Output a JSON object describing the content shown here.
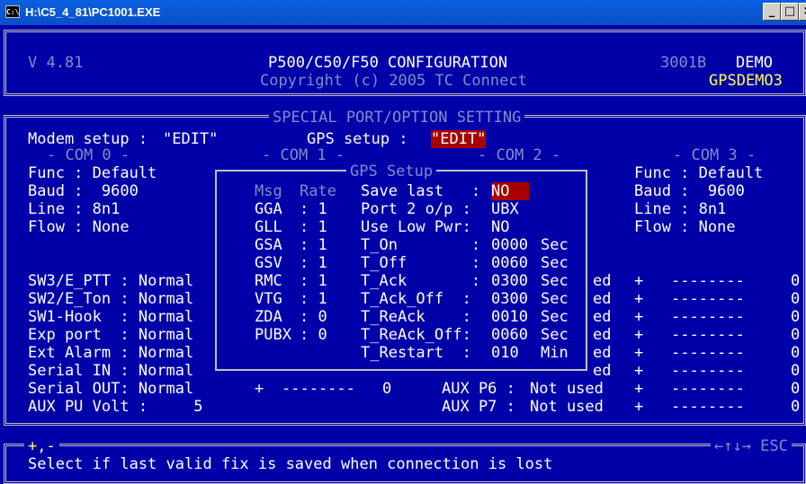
{
  "window": {
    "title": "H:\\C5_4_81\\PC1001.EXE",
    "icon": "C:\\",
    "min_label": "_",
    "max_label": "□",
    "close_label": "×"
  },
  "header": {
    "version": "V 4.81",
    "product": "P500/C50/F50 CONFIGURATION",
    "copyright": "Copyright (c) 2005 TC Connect",
    "unit_id": "3001B",
    "mode": "DEMO",
    "config_name": "GPSDEMO3"
  },
  "panel": {
    "title": "SPECIAL PORT/OPTION SETTING",
    "modem_label": "Modem setup :",
    "modem_value": "\"EDIT\"",
    "gps_label": "GPS setup :",
    "gps_value": "\"EDIT\""
  },
  "com0": {
    "title": "- COM 0 -",
    "func": "Func : Default",
    "baud": "Baud :  9600",
    "line": "Line : 8n1",
    "flow": "Flow : None"
  },
  "com1": {
    "title": "- COM 1 -"
  },
  "com2": {
    "title": "- COM 2 -"
  },
  "com3": {
    "title": "- COM 3 -",
    "func": "Func : Default",
    "baud": "Baud :  9600",
    "line": "Line : 8n1",
    "flow": "Flow : None"
  },
  "left_settings": [
    {
      "label": "SW3/E_PTT",
      "sep": " : ",
      "value": "Normal"
    },
    {
      "label": "SW2/E_Ton",
      "sep": " : ",
      "value": "Normal"
    },
    {
      "label": "SW1-Hook ",
      "sep": " : ",
      "value": "Normal"
    },
    {
      "label": "Exp port ",
      "sep": " : ",
      "value": "Normal"
    },
    {
      "label": "Ext Alarm",
      "sep": " : ",
      "value": "Normal"
    },
    {
      "label": "Serial IN",
      "sep": " : ",
      "value": "Normal"
    },
    {
      "label": "Serial OUT",
      "sep": ": ",
      "value": "Normal"
    },
    {
      "label": "AUX PU Volt",
      "sep": " :     ",
      "value": "5"
    }
  ],
  "aux": {
    "com1_row": {
      "plus": "+",
      "dashes": "--------",
      "count": "0"
    },
    "p6": {
      "label": "AUX P6 :",
      "value": "Not used"
    },
    "p7": {
      "label": "AUX P7 :",
      "value": "Not used"
    },
    "ed_label": "ed"
  },
  "right_rows": [
    {
      "plus": "+",
      "dashes": "--------",
      "count": "0"
    },
    {
      "plus": "+",
      "dashes": "--------",
      "count": "0"
    },
    {
      "plus": "+",
      "dashes": "--------",
      "count": "0"
    },
    {
      "plus": "+",
      "dashes": "--------",
      "count": "0"
    },
    {
      "plus": "+",
      "dashes": "--------",
      "count": "0"
    },
    {
      "plus": "+",
      "dashes": "--------",
      "count": "0"
    },
    {
      "plus": "+",
      "dashes": "--------",
      "count": "0"
    },
    {
      "plus": "+",
      "dashes": "--------",
      "count": "0"
    }
  ],
  "gps_dialog": {
    "title": "GPS Setup",
    "col_msg": "Msg",
    "col_rate": "Rate",
    "messages": [
      {
        "name": "GGA",
        "rate": ": 1"
      },
      {
        "name": "GLL",
        "rate": ": 1"
      },
      {
        "name": "GSA",
        "rate": ": 1"
      },
      {
        "name": "GSV",
        "rate": ": 1"
      },
      {
        "name": "RMC",
        "rate": ": 1"
      },
      {
        "name": "VTG",
        "rate": ": 1"
      },
      {
        "name": "ZDA",
        "rate": ": 0"
      },
      {
        "name": "PUBX",
        "rate": ": 0"
      }
    ],
    "settings": [
      {
        "label": "Save last   :",
        "value": "NO",
        "unit": ""
      },
      {
        "label": "Port 2 o/p :",
        "value": "UBX",
        "unit": ""
      },
      {
        "label": "Use Low Pwr:",
        "value": "NO",
        "unit": ""
      },
      {
        "label": "T_On        :",
        "value": "0000",
        "unit": "Sec"
      },
      {
        "label": "T_Off       :",
        "value": "0060",
        "unit": "Sec"
      },
      {
        "label": "T_Ack       :",
        "value": "0300",
        "unit": "Sec"
      },
      {
        "label": "T_Ack_Off  :",
        "value": "0300",
        "unit": "Sec"
      },
      {
        "label": "T_ReAck    :",
        "value": "0010",
        "unit": "Sec"
      },
      {
        "label": "T_ReAck_Off:",
        "value": "0060",
        "unit": "Sec"
      },
      {
        "label": "T_Restart  :",
        "value": "010",
        "unit": "Min"
      }
    ]
  },
  "footer": {
    "keys_left": "+,-",
    "keys_right": "←↑↓→ ESC",
    "help": "Select if last valid fix is saved when connection is lost"
  },
  "colors": {
    "background": "#0000a8",
    "highlight": "#a80000",
    "accent": "#ffff55",
    "text": "#c0c0c0"
  }
}
